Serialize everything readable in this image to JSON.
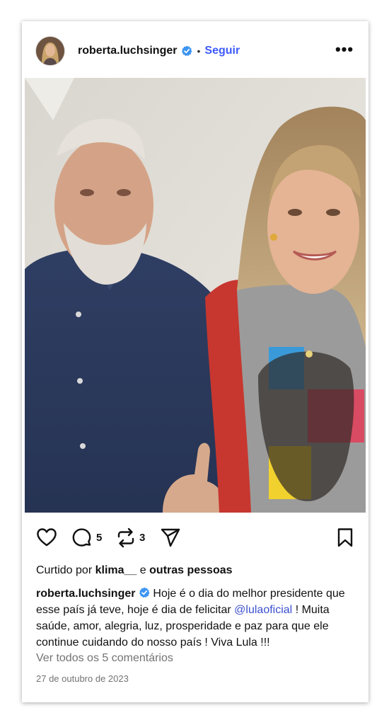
{
  "header": {
    "username": "roberta.luchsinger",
    "separator": "•",
    "follow_label": "Seguir",
    "more_label": "•••",
    "verified_color": "#3d95f2"
  },
  "post": {
    "image_alt": "Foto de um homem de camisa azul e uma mulher com camiseta estampada",
    "comments_count": "5",
    "reposts_count": "3"
  },
  "likes": {
    "prefix": "Curtido por",
    "user": "klima__",
    "connector": "e",
    "others": "outras pessoas"
  },
  "caption": {
    "username": "roberta.luchsinger",
    "text_before": "Hoje é o dia do melhor presidente que esse país já teve, hoje é dia de felicitar",
    "mention": "@lulaoficial",
    "text_after": "! Muita saúde, amor, alegria, luz, prosperidade e paz para que ele continue cuidando do nosso país ! Viva Lula !!!"
  },
  "comments_link": "Ver todos os 5 comentários",
  "date": "27 de outubro de 2023",
  "colors": {
    "accent": "#3d5afe",
    "mention": "#3b50ce",
    "muted": "#737373"
  }
}
